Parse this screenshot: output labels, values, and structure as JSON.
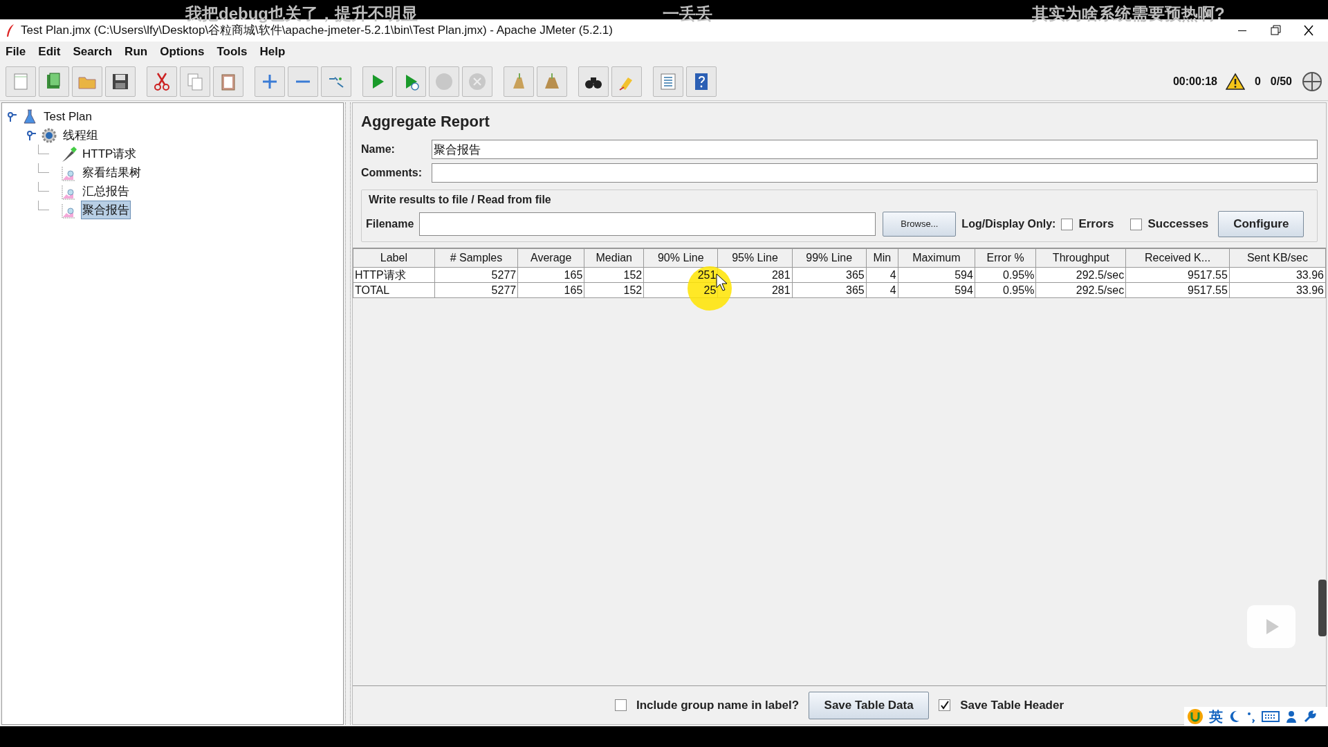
{
  "subtitles": [
    "我把debug也关了，提升不明显",
    "一丢丢",
    "其实为啥系统需要预热啊?"
  ],
  "window": {
    "title": "Test Plan.jmx (C:\\Users\\lfy\\Desktop\\谷粒商城\\软件\\apache-jmeter-5.2.1\\bin\\Test Plan.jmx) - Apache JMeter (5.2.1)"
  },
  "menu": [
    "File",
    "Edit",
    "Search",
    "Run",
    "Options",
    "Tools",
    "Help"
  ],
  "status": {
    "timer": "00:00:18",
    "warnings": "0",
    "threads": "0/50"
  },
  "tree": [
    {
      "label": "Test Plan",
      "kind": "plan",
      "expanded": true,
      "selected": false,
      "children": [
        {
          "label": "线程组",
          "kind": "group",
          "expanded": true,
          "selected": false,
          "children": [
            {
              "label": "HTTP请求",
              "kind": "sampler",
              "selected": false
            },
            {
              "label": "察看结果树",
              "kind": "listener",
              "selected": false
            },
            {
              "label": "汇总报告",
              "kind": "listener",
              "selected": false
            },
            {
              "label": "聚合报告",
              "kind": "listener",
              "selected": true
            }
          ]
        }
      ]
    }
  ],
  "panel": {
    "title": "Aggregate Report",
    "name_label": "Name:",
    "name_value": "聚合报告",
    "comments_label": "Comments:",
    "file_group": "Write results to file / Read from file",
    "filename_label": "Filename",
    "browse": "Browse...",
    "log_label": "Log/Display Only:",
    "errors": {
      "label": "Errors",
      "checked": false
    },
    "successes": {
      "label": "Successes",
      "checked": false
    },
    "configure": "Configure"
  },
  "table": {
    "columns": [
      "Label",
      "# Samples",
      "Average",
      "Median",
      "90% Line",
      "95% Line",
      "99% Line",
      "Min",
      "Maximum",
      "Error %",
      "Throughput",
      "Received K...",
      "Sent KB/sec"
    ],
    "rows": [
      [
        "HTTP请求",
        "5277",
        "165",
        "152",
        "251",
        "281",
        "365",
        "4",
        "594",
        "0.95%",
        "292.5/sec",
        "9517.55",
        "33.96"
      ],
      [
        "TOTAL",
        "5277",
        "165",
        "152",
        "25",
        "281",
        "365",
        "4",
        "594",
        "0.95%",
        "292.5/sec",
        "9517.55",
        "33.96"
      ]
    ]
  },
  "footer": {
    "include_group": {
      "label": "Include group name in label?",
      "checked": false
    },
    "save_data": "Save Table Data",
    "save_header": {
      "label": "Save Table Header",
      "checked": true
    }
  },
  "ime": {
    "mode": "英"
  }
}
